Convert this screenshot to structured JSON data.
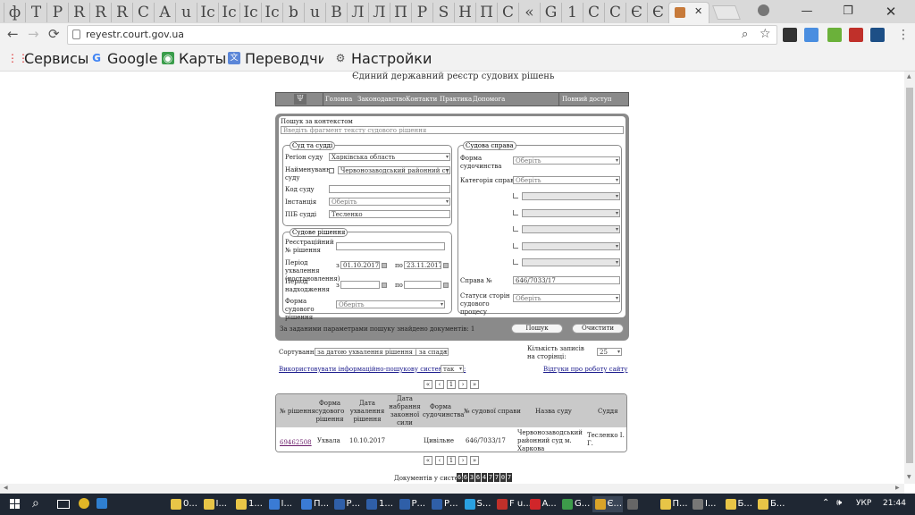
{
  "browser": {
    "tab_icons": [
      "ф",
      "T",
      "P",
      "R",
      "R",
      "R",
      "C",
      "A",
      "u",
      "Ic",
      "Ic",
      "Ic",
      "Ic",
      "b",
      "u",
      "B",
      "Л",
      "Л",
      "П",
      "P",
      "S",
      "H",
      "П",
      "C",
      "«",
      "G",
      "1",
      "C",
      "C",
      "Є",
      "Є"
    ],
    "active_tab_close": "✕",
    "window_controls": {
      "minimize": "—",
      "maximize": "❐",
      "close": "✕"
    },
    "url": "reyestr.court.gov.ua",
    "back_icon": "←",
    "forward_icon": "→",
    "reload_icon": "⟳",
    "bookmarks": [
      {
        "icon": "⋮⋮",
        "label": "Сервисы"
      },
      {
        "icon": "G",
        "label": "Google"
      },
      {
        "icon": "◉",
        "label": "Карты"
      },
      {
        "icon": "文",
        "label": "Переводчик"
      },
      {
        "icon": "⚙",
        "label": "Настройки"
      }
    ]
  },
  "site": {
    "title": "Єдиний державний реєстр судових рішень",
    "nav": [
      "Головна",
      "Законодавство",
      "Контакти",
      "Практика",
      "Допомога"
    ],
    "full_access": "Повний доступ",
    "search": {
      "label": "Пошук за контекстом",
      "placeholder": "Введіть фрагмент тексту судового рішення"
    },
    "court_fs": {
      "legend": "Суд та судді",
      "region_label": "Регіон суду",
      "region_value": "Харківська область",
      "court_name_label": "Найменування суду",
      "court_name_value": "Червонозаводський районний суд м. Х",
      "court_code_label": "Код суду",
      "court_code_value": "",
      "instance_label": "Інстанція",
      "instance_value": "Оберіть",
      "judge_label": "ПІБ судді",
      "judge_value": "Тесленко"
    },
    "decision_fs": {
      "legend": "Судове рішення",
      "reg_no_label": "Реєстраційний № рішення",
      "reg_no_value": "",
      "period_label": "Період ухвалення (постановлення)",
      "from": "з",
      "to": "по",
      "date_from": "01.10.2017",
      "date_to": "23.11.2017",
      "reg_period_label": "Період надходження",
      "reg_from": "",
      "reg_to": "",
      "form_label": "Форма судового рішення",
      "form_value": "Оберіть"
    },
    "case_fs": {
      "legend": "Судова справа",
      "proceeding_label": "Форма судочинства",
      "proceeding_value": "Оберіть",
      "category_label": "Категорія справи",
      "category_value": "Оберіть",
      "case_no_label": "Справа №",
      "case_no_value": "646/7033/17",
      "party_status_label": "Статуси сторін судового процесу",
      "party_status_value": "Оберіть"
    },
    "found_text": "За заданими параметрами пошуку знайдено документів: 1",
    "search_button": "Пошук",
    "clear_button": "Очистити",
    "sort_label": "Сортування:",
    "sort_value": "за датою ухвалення рішення | за спаданням",
    "per_page_label": "Кількість записів на сторінці:",
    "per_page_value": "25",
    "use_info_label": "Використовувати інформаційно-пошукову систему базу:",
    "use_info_value": "так",
    "feedback": "Відгуки про роботу сайту",
    "pagination": [
      "«",
      "‹",
      "1",
      "›",
      "»"
    ],
    "table": {
      "headers": [
        "№ рішення",
        "Форма судового рішення",
        "Дата ухвалення рішення",
        "Дата набрання законної сили",
        "Форма судочинства",
        "№ судової справи",
        "Назва суду",
        "Суддя"
      ],
      "rows": [
        [
          "69462508",
          "Ухвала",
          "10.10.2017",
          "",
          "Цивільне",
          "646/7033/17",
          "Червонозаводський районний суд м. Харкова",
          "Тесленко І. Г."
        ]
      ]
    },
    "docs_count_label": "Документів у системі:",
    "docs_count_digits": [
      "6",
      "6",
      "3",
      "6",
      "4",
      "7",
      "7",
      "0",
      "7"
    ]
  },
  "taskbar": {
    "items": [
      "0...",
      "I...",
      "1...",
      "I...",
      "П...",
      "Р...",
      "1...",
      "Р...",
      "Р...",
      "S...",
      "F u...",
      "A...",
      "G...",
      "Є...",
      "",
      "П...",
      "I...",
      "Б...",
      "Б..."
    ],
    "lang": "УКР",
    "time": "21:44"
  }
}
